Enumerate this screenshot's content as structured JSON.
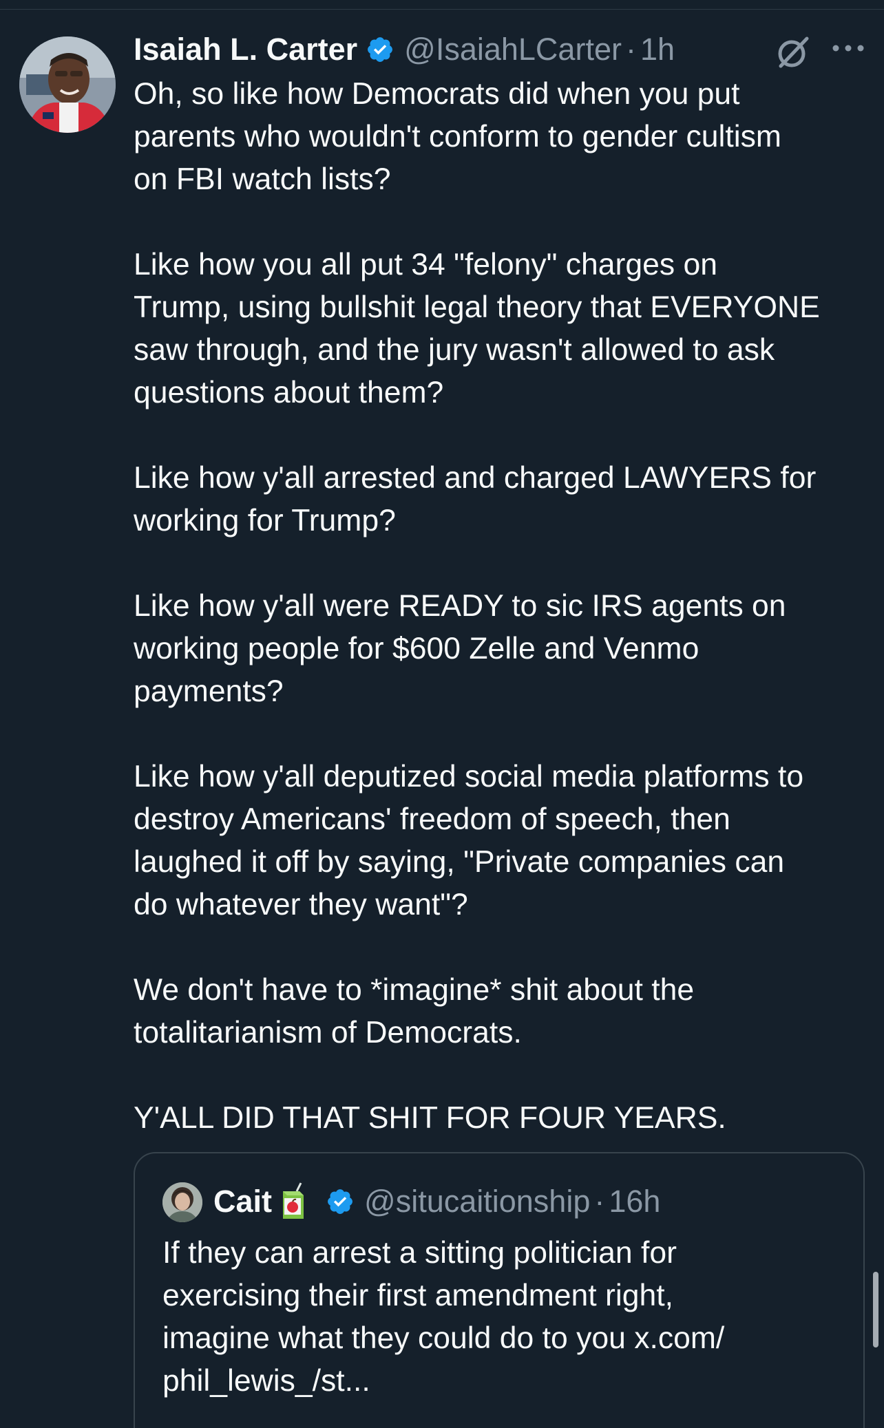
{
  "tweet": {
    "display_name": "Isaiah L. Carter",
    "handle": "@IsaiahLCarter",
    "separator": "·",
    "time": "1h",
    "paragraphs": [
      "Oh, so like how Democrats did when you put\nparents who wouldn't conform to gender cultism\non FBI watch lists?",
      "Like how you all put 34 \"felony\" charges on\nTrump, using bullshit legal theory that EVERYONE\nsaw through, and the jury wasn't allowed to ask\nquestions about them?",
      "Like how y'all arrested and charged LAWYERS for\nworking for Trump?",
      "Like how y'all were READY to sic IRS agents on\nworking people for $600 Zelle and Venmo\npayments?",
      "Like how y'all deputized social media platforms to\ndestroy Americans' freedom of speech, then\nlaughed it off by saying, \"Private companies can\ndo whatever they want\"?",
      "We don't have to *imagine* shit about the\ntotalitarianism of Democrats.",
      "Y'ALL DID THAT SHIT FOR FOUR YEARS."
    ]
  },
  "quote": {
    "display_name": "Cait",
    "handle": "@situcaitionship",
    "separator": "·",
    "time": "16h",
    "text": "If they can arrest a sitting politician for\nexercising their first amendment right,\nimagine what they could do to you x.com/\nphil_lewis_/st..."
  },
  "icons": {
    "verified": "verified-badge-icon",
    "grok": "grok-icon",
    "more": "more-options-icon",
    "juice": "juice-box-emoji-icon"
  },
  "colors": {
    "background": "#15202b",
    "text": "#f7f9f9",
    "secondary_text": "#8b98a5",
    "verified_blue": "#1d9bf0",
    "border": "#38444d"
  }
}
